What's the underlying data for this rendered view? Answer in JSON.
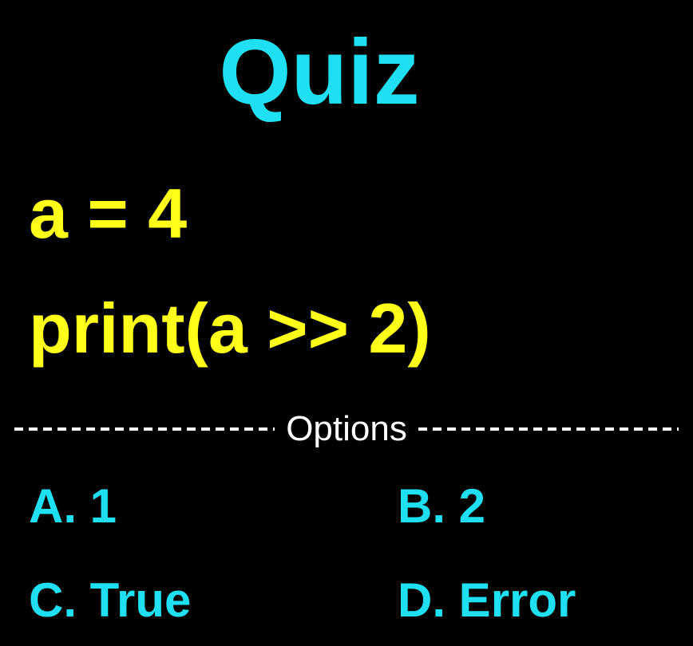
{
  "title": "Quiz",
  "code": {
    "line1": "a = 4",
    "line2": "print(a >> 2)"
  },
  "options_label": "Options",
  "options": [
    {
      "label": "A. 1"
    },
    {
      "label": "B. 2"
    },
    {
      "label": "C. True"
    },
    {
      "label": "D. Error"
    }
  ],
  "colors": {
    "background": "#000000",
    "title": "#1EE0F2",
    "code": "#FFFF1A",
    "options": "#1EE0F2",
    "divider": "#FFFFFF"
  }
}
